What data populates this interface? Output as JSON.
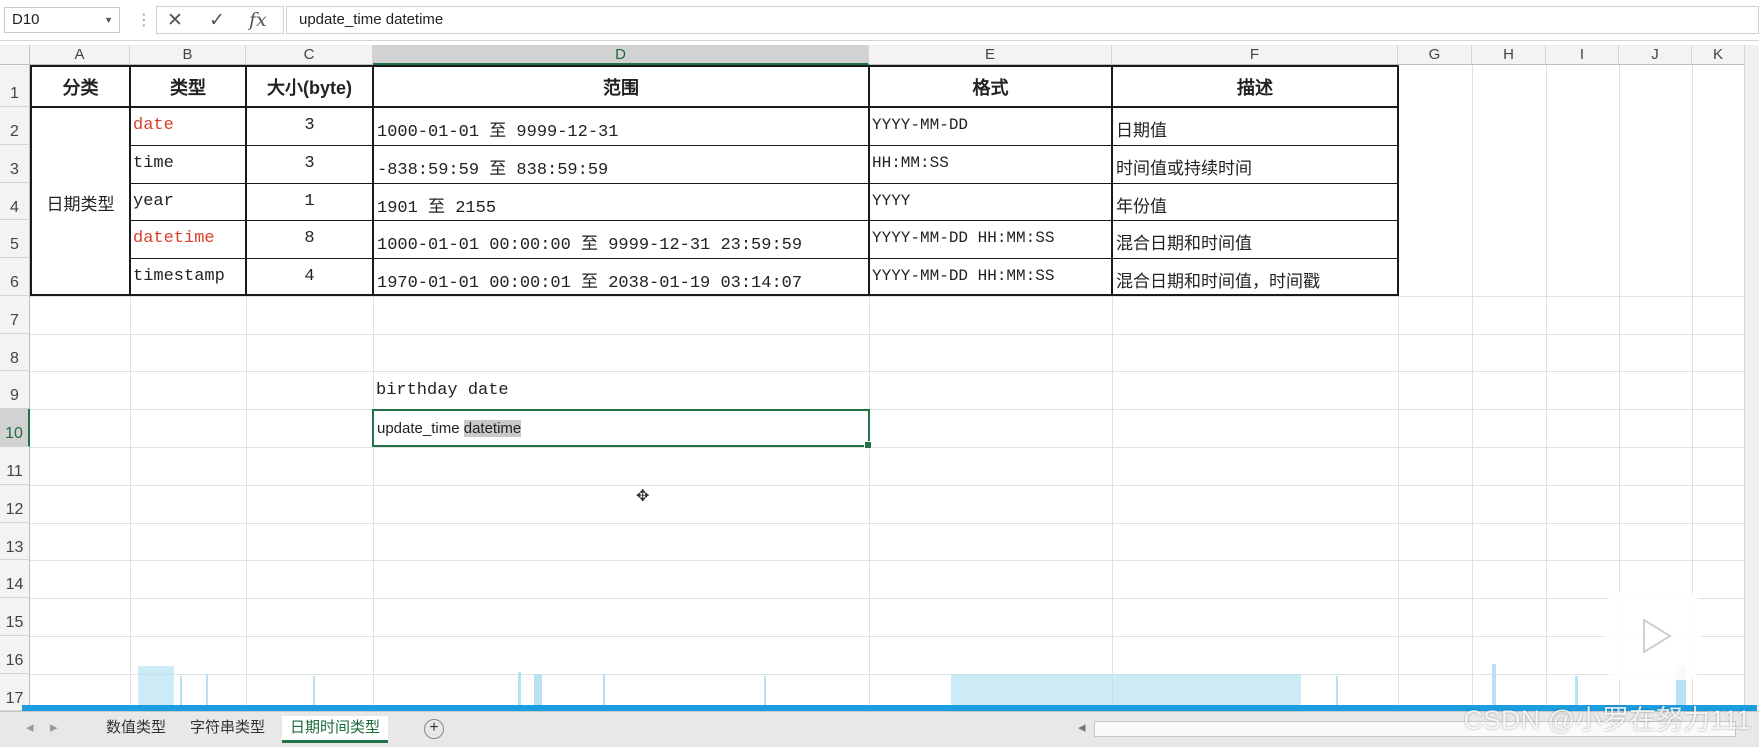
{
  "formula_bar": {
    "name_box": "D10",
    "cancel_symbol": "✕",
    "enter_symbol": "✓",
    "fx_symbol": "fx",
    "formula": "update_time datetime"
  },
  "columns": [
    "A",
    "B",
    "C",
    "D",
    "E",
    "F",
    "G",
    "H",
    "I",
    "J",
    "K"
  ],
  "selected_column": "D",
  "rows": [
    "1",
    "2",
    "3",
    "4",
    "5",
    "6",
    "7",
    "8",
    "9",
    "10",
    "11",
    "12",
    "13",
    "14",
    "15",
    "16",
    "17"
  ],
  "selected_row": "10",
  "table": {
    "headers": {
      "category": "分类",
      "type": "类型",
      "size": "大小(byte)",
      "range": "范围",
      "format": "格式",
      "description": "描述"
    },
    "category_value": "日期类型",
    "rows": [
      {
        "type": "date",
        "size": "3",
        "range": "1000-01-01 至 9999-12-31",
        "format": "YYYY-MM-DD",
        "description": "日期值"
      },
      {
        "type": "time",
        "size": "3",
        "range": "-838:59:59 至 838:59:59",
        "format": "HH:MM:SS",
        "description": "时间值或持续时间"
      },
      {
        "type": "year",
        "size": "1",
        "range": "1901 至 2155",
        "format": "YYYY",
        "description": "年份值"
      },
      {
        "type": "datetime",
        "size": "8",
        "range": "1000-01-01 00:00:00 至 9999-12-31 23:59:59",
        "format": "YYYY-MM-DD HH:MM:SS",
        "description": "混合日期和时间值"
      },
      {
        "type": "timestamp",
        "size": "4",
        "range": "1970-01-01 00:00:01 至 2038-01-19 03:14:07",
        "format": "YYYY-MM-DD HH:MM:SS",
        "description": "混合日期和时间值，时间戳"
      }
    ]
  },
  "cells": {
    "D9": "birthday date",
    "D10_prefix": "update_time ",
    "D10_selected": "datetime"
  },
  "sheet_tabs": [
    {
      "label": "数值类型",
      "active": false
    },
    {
      "label": "字符串类型",
      "active": false
    },
    {
      "label": "日期时间类型",
      "active": true
    }
  ],
  "add_sheet_symbol": "+",
  "watermark": "CSDN @小罗在努力111",
  "colors": {
    "accent": "#217346",
    "red_text": "#d9402b",
    "progress": "#1a9ee0"
  }
}
